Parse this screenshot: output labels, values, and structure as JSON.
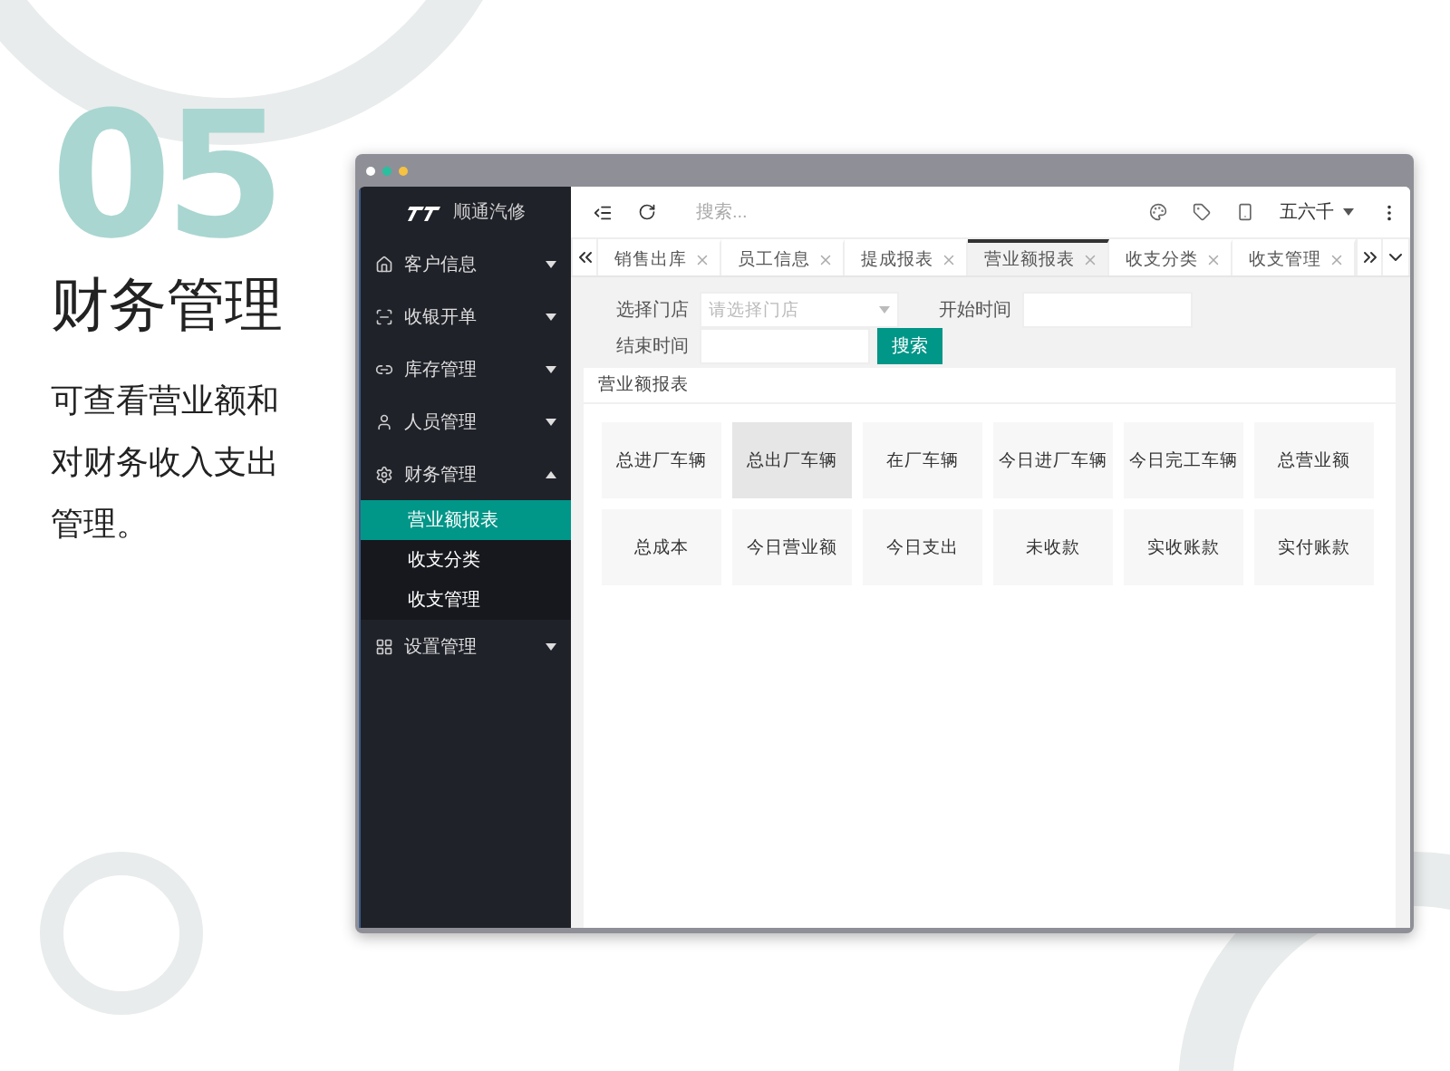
{
  "intro": {
    "number": "05",
    "title": "财务管理",
    "description": "可查看营业额和对财务收入支出管理。"
  },
  "window": {
    "brand": "顺通汽修",
    "sidebar": {
      "items": [
        {
          "label": "客户信息",
          "expanded": false
        },
        {
          "label": "收银开单",
          "expanded": false
        },
        {
          "label": "库存管理",
          "expanded": false
        },
        {
          "label": "人员管理",
          "expanded": false
        },
        {
          "label": "财务管理",
          "expanded": true,
          "children": [
            {
              "label": "营业额报表",
              "selected": true
            },
            {
              "label": "收支分类",
              "selected": false
            },
            {
              "label": "收支管理",
              "selected": false
            }
          ]
        },
        {
          "label": "设置管理",
          "expanded": false
        }
      ]
    },
    "search": {
      "placeholder": "搜索..."
    },
    "user": "五六千",
    "tabs": [
      {
        "label": "销售出库",
        "selected": false
      },
      {
        "label": "员工信息",
        "selected": false
      },
      {
        "label": "提成报表",
        "selected": false
      },
      {
        "label": "营业额报表",
        "selected": true
      },
      {
        "label": "收支分类",
        "selected": false
      },
      {
        "label": "收支管理",
        "selected": false
      }
    ],
    "filters": {
      "store_label": "选择门店",
      "store_placeholder": "请选择门店",
      "start_label": "开始时间",
      "end_label": "结束时间",
      "search_button": "搜索"
    },
    "panel": {
      "title": "营业额报表",
      "cards": [
        {
          "label": "总进厂车辆",
          "selected": false
        },
        {
          "label": "总出厂车辆",
          "selected": true
        },
        {
          "label": "在厂车辆",
          "selected": false
        },
        {
          "label": "今日进厂车辆",
          "selected": false
        },
        {
          "label": "今日完工车辆",
          "selected": false
        },
        {
          "label": "总营业额",
          "selected": false
        },
        {
          "label": "总成本",
          "selected": false
        },
        {
          "label": "今日营业额",
          "selected": false
        },
        {
          "label": "今日支出",
          "selected": false
        },
        {
          "label": "未收款",
          "selected": false
        },
        {
          "label": "实收账款",
          "selected": false
        },
        {
          "label": "实付账款",
          "selected": false
        }
      ]
    }
  }
}
